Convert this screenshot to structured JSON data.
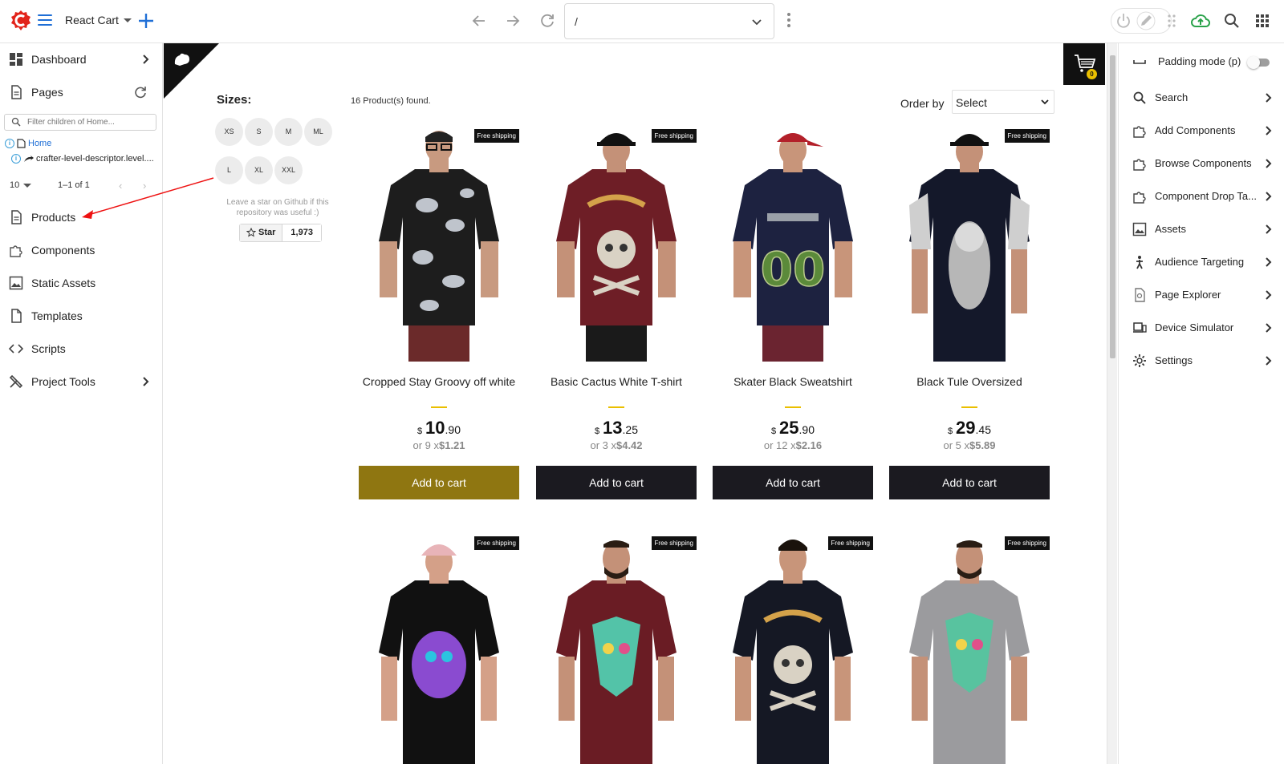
{
  "topbar": {
    "site_name": "React Cart",
    "url_value": "/",
    "colors": {
      "accent": "#1f6fd6",
      "logo_red": "#e2241b",
      "cloud_green": "#2aa24a"
    }
  },
  "sidebar": {
    "items": [
      {
        "label": "Dashboard",
        "icon": "dashboard-icon"
      },
      {
        "label": "Pages",
        "icon": "page-icon"
      },
      {
        "label": "Products",
        "icon": "page-icon"
      },
      {
        "label": "Components",
        "icon": "puzzle-icon"
      },
      {
        "label": "Static Assets",
        "icon": "image-icon"
      },
      {
        "label": "Templates",
        "icon": "file-icon"
      },
      {
        "label": "Scripts",
        "icon": "code-icon"
      },
      {
        "label": "Project Tools",
        "icon": "tools-icon"
      }
    ],
    "filter_placeholder": "Filter children of Home...",
    "tree": {
      "home_label": "Home",
      "descriptor_label": "crafter-level-descriptor.level...."
    },
    "pager": {
      "rows": "10",
      "range": "1–1 of 1"
    }
  },
  "store": {
    "sizes_title": "Sizes:",
    "sizes": [
      "XS",
      "S",
      "M",
      "ML",
      "L",
      "XL",
      "XXL"
    ],
    "star_text": "Leave a star on Github if this repository was useful :)",
    "star_label": "Star",
    "star_count": "1,973",
    "found_text": "16 Product(s) found.",
    "order_label": "Order by",
    "order_value": "Select",
    "cart_count": "0",
    "ship_label": "Free shipping",
    "products": [
      {
        "title": "Cropped Stay Groovy off white",
        "currency": "$",
        "int": "10",
        "dec": ".90",
        "inst_prefix": "or 9 x",
        "inst_value": "$1.21",
        "button": "Add to cart"
      },
      {
        "title": "Basic Cactus White T-shirt",
        "currency": "$",
        "int": "13",
        "dec": ".25",
        "inst_prefix": "or 3 x",
        "inst_value": "$4.42",
        "button": "Add to cart"
      },
      {
        "title": "Skater Black Sweatshirt",
        "currency": "$",
        "int": "25",
        "dec": ".90",
        "inst_prefix": "or 12 x",
        "inst_value": "$2.16",
        "button": "Add to cart"
      },
      {
        "title": "Black Tule Oversized",
        "currency": "$",
        "int": "29",
        "dec": ".45",
        "inst_prefix": "or 5 x",
        "inst_value": "$5.89",
        "button": "Add to cart"
      }
    ],
    "colors": {
      "button": "#1b1a20",
      "button_hover": "#8f7611",
      "dash": "#eabf00"
    }
  },
  "rightpanel": {
    "padding_mode": "Padding mode (p)",
    "items": [
      {
        "label": "Search",
        "icon": "search-icon"
      },
      {
        "label": "Add Components",
        "icon": "puzzle-icon"
      },
      {
        "label": "Browse Components",
        "icon": "puzzle-icon"
      },
      {
        "label": "Component Drop Ta...",
        "icon": "puzzle-icon"
      },
      {
        "label": "Assets",
        "icon": "image-icon"
      },
      {
        "label": "Audience Targeting",
        "icon": "person-icon"
      },
      {
        "label": "Page Explorer",
        "icon": "page-explorer-icon"
      },
      {
        "label": "Device Simulator",
        "icon": "devices-icon"
      },
      {
        "label": "Settings",
        "icon": "gear-icon"
      }
    ]
  }
}
